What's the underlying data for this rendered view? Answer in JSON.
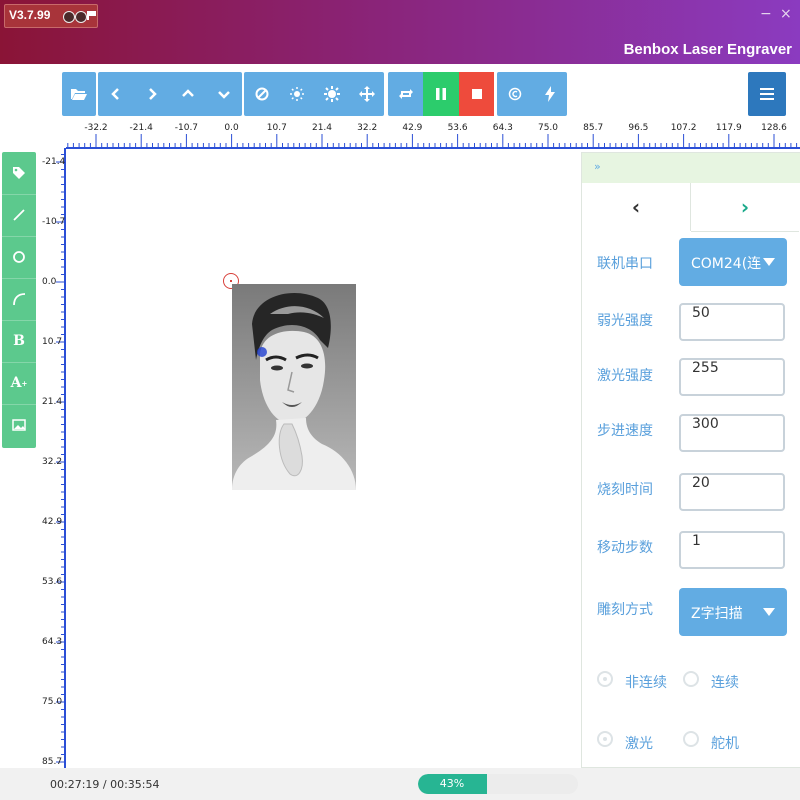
{
  "titlebar": {
    "version": "V3.7.99",
    "app_title": "Benbox Laser Engraver",
    "minimize": "−",
    "close": "×"
  },
  "toolbar": {
    "icons": [
      "folder-open-icon",
      "chevron-left-icon",
      "chevron-right-icon",
      "chevron-up-icon",
      "chevron-down-icon",
      "ban-icon",
      "brightness-low-icon",
      "brightness-high-icon",
      "move-icon",
      "repeat-icon",
      "pause-icon",
      "stop-icon",
      "copyright-icon",
      "bolt-icon",
      "menu-icon"
    ],
    "colors": {
      "blue": "#62ace3",
      "green": "#2ccc6c",
      "red": "#ee4b3c",
      "menu": "#2d78bd"
    }
  },
  "ruler": {
    "x_labels": [
      "-32.2",
      "-21.4",
      "-10.7",
      "0.0",
      "10.7",
      "21.4",
      "32.2",
      "42.9",
      "53.6",
      "64.3",
      "75.0",
      "85.7",
      "96.5",
      "107.2",
      "117.9",
      "128.6"
    ],
    "y_labels": [
      "-21.4",
      "-10.7",
      "0.0",
      "10.7",
      "21.4",
      "32.2",
      "42.9",
      "53.6",
      "64.3",
      "75.0",
      "85.7"
    ]
  },
  "palette": {
    "tools": [
      "tag-icon",
      "line-icon",
      "circle-icon",
      "arc-icon",
      "bold-text-icon",
      "text-size-icon",
      "image-icon"
    ],
    "glyphs": {
      "bold": "B",
      "text": "A"
    }
  },
  "panel": {
    "header": "»",
    "tab_left": "‹",
    "tab_right": "›",
    "port": {
      "label": "联机串口",
      "value": "COM24(连"
    },
    "weak_power": {
      "label": "弱光强度",
      "value": "50"
    },
    "laser_power": {
      "label": "激光强度",
      "value": "255"
    },
    "step_speed": {
      "label": "步进速度",
      "value": "300"
    },
    "burn_time": {
      "label": "烧刻时间",
      "value": "20"
    },
    "move_steps": {
      "label": "移动步数",
      "value": "1"
    },
    "engrave_mode": {
      "label": "雕刻方式",
      "value": "Z字扫描"
    },
    "radios": {
      "noncontinuous": "非连续",
      "continuous": "连续",
      "laser": "激光",
      "servo": "舵机"
    }
  },
  "status": {
    "time": "00:27:19 / 00:35:54",
    "progress_text": "43%",
    "progress": 0.43
  }
}
